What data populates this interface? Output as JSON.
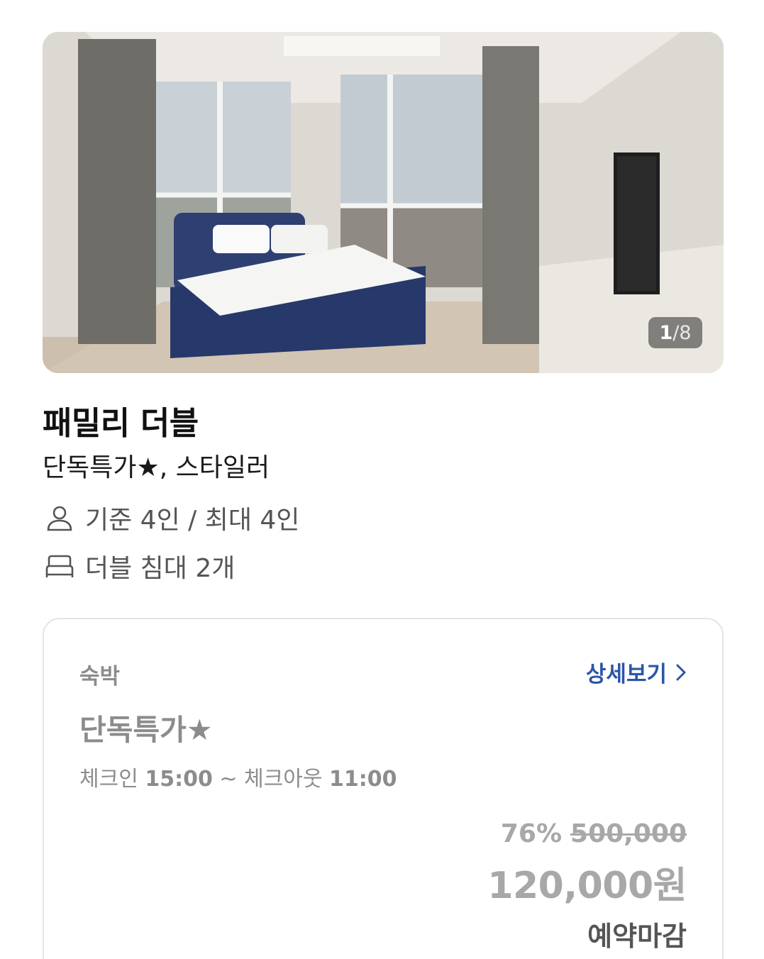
{
  "gallery": {
    "current": "1",
    "separator": "/",
    "total": "8"
  },
  "room": {
    "title": "패밀리 더블",
    "subtitle": "단독특가★, 스타일러",
    "capacity": "기준 4인 / 최대 4인",
    "bed": "더블 침대 2개",
    "capacity_icon": "person-icon",
    "bed_icon": "bed-icon"
  },
  "plan": {
    "type": "숙박",
    "detail_label": "상세보기",
    "name": "단독특가★",
    "checkin_label": "체크인",
    "checkin_time": "15:00",
    "tilde": "~",
    "checkout_label": "체크아웃",
    "checkout_time": "11:00",
    "discount": "76%",
    "original_price": "500,000",
    "final_price": "120,000원",
    "status": "예약마감"
  },
  "colors": {
    "link": "#2b56a6",
    "muted": "#8c8c8c",
    "price_disabled": "#a8a8a8"
  }
}
